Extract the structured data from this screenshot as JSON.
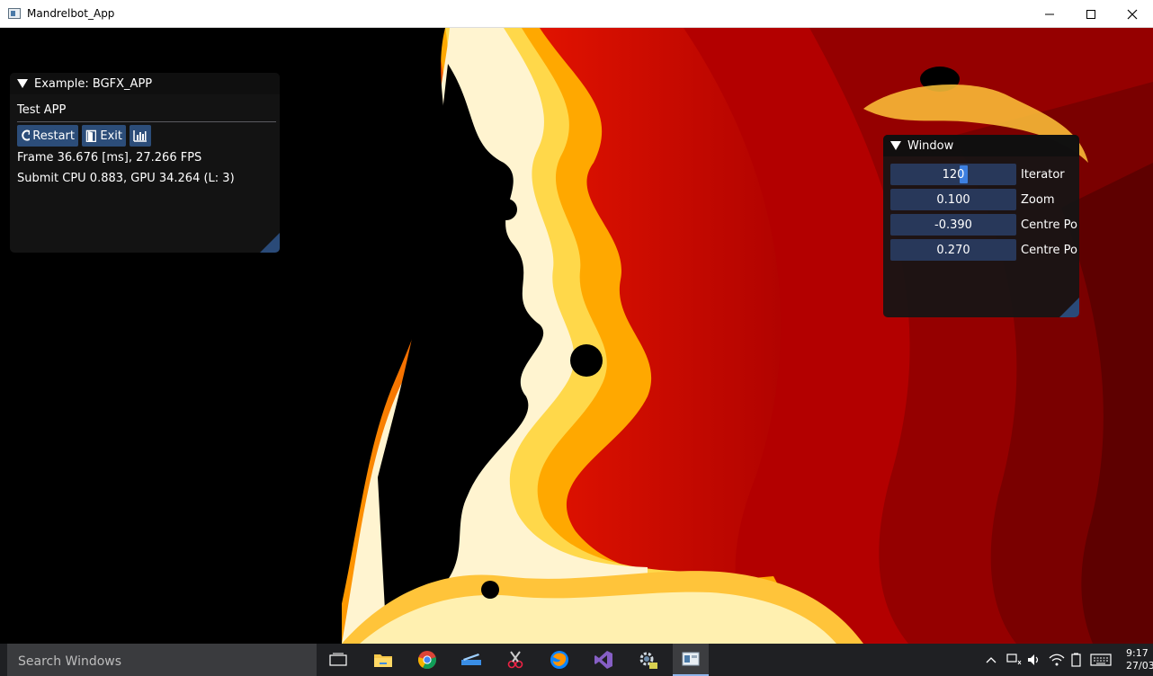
{
  "window": {
    "title": "Mandrelbot_App"
  },
  "example_panel": {
    "header": "Example: BGFX_APP",
    "subtitle": "Test APP",
    "buttons": {
      "restart": "Restart",
      "exit": "Exit"
    },
    "frame_line": "Frame 36.676 [ms], 27.266 FPS",
    "submit_line": "Submit CPU 0.883, GPU 34.264 (L: 3)"
  },
  "params_panel": {
    "header": "Window",
    "fields": [
      {
        "value": "120",
        "label": "Iterator"
      },
      {
        "value": "0.100",
        "label": "Zoom"
      },
      {
        "value": "-0.390",
        "label": "Centre Po"
      },
      {
        "value": "0.270",
        "label": "Centre Po"
      }
    ]
  },
  "taskbar": {
    "search_placeholder": "Search Windows",
    "clock_time": "9:17",
    "clock_date": "27/03"
  },
  "colors": {
    "panel_accent": "#2c4d79",
    "field_bg": "#28385a",
    "fractal_bright": "#ffd23a",
    "fractal_mid": "#e00000",
    "fractal_dark": "#7a0000"
  }
}
